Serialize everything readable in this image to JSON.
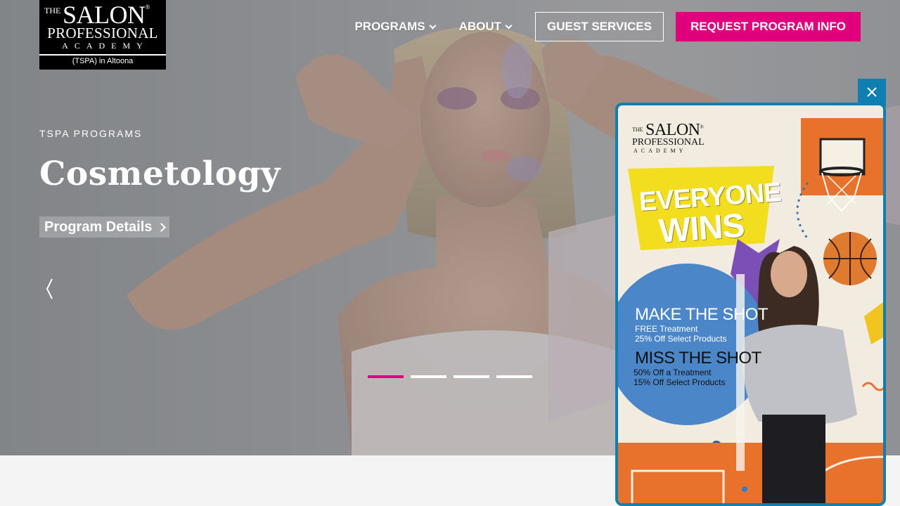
{
  "header": {
    "logo": {
      "the": "THE",
      "salon": "SALON",
      "registered": "®",
      "professional": "PROFESSIONAL",
      "academy": "ACADEMY",
      "location": "(TSPA) in Altoona"
    },
    "nav": {
      "programs": "PROGRAMS",
      "about": "ABOUT",
      "guest_services": "GUEST SERVICES",
      "request_info": "REQUEST PROGRAM INFO"
    }
  },
  "hero": {
    "eyebrow": "TSPA PROGRAMS",
    "title": "Cosmetology",
    "cta": "Program Details",
    "slides_total": 4,
    "active_slide": 1
  },
  "popup": {
    "logo": {
      "the": "THE",
      "salon": "SALON",
      "registered": "®",
      "professional": "PROFESSIONAL",
      "academy": "ACADEMY"
    },
    "headline_1": "EVERYONE",
    "headline_2": "WINS",
    "make_shot": "MAKE THE SHOT",
    "make_line_1": "FREE Treatment",
    "make_line_2": "25% Off Select Products",
    "miss_shot": "MISS THE SHOT",
    "miss_line_1": "50% Off a Treatment",
    "miss_line_2": "15% Off Select Products"
  },
  "colors": {
    "brand_pink": "#e0007b",
    "popup_border": "#0e7fb0",
    "popup_yellow": "#f2dd1f",
    "popup_blue": "#4b86c9",
    "popup_orange": "#e8712b"
  }
}
